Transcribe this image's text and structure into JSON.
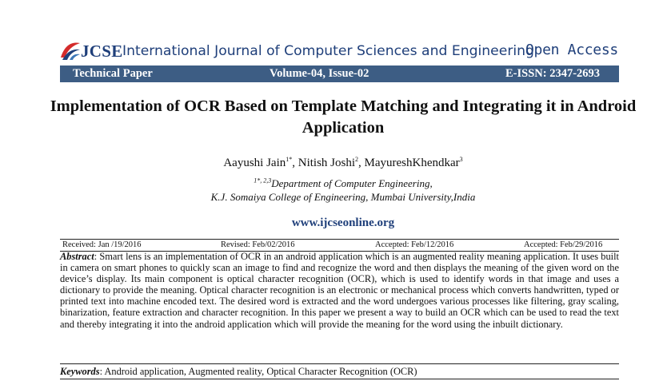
{
  "header": {
    "logo_text": "JCSE",
    "journal_name": "International Journal of Computer Sciences and Engineering",
    "open_access": "Open Access",
    "paper_type": "Technical Paper",
    "volume_issue": "Volume-04, Issue-02",
    "eissn": "E-ISSN: 2347-2693",
    "colors": {
      "brand": "#1f3f7a",
      "bar": "#3d5d84",
      "logo_red": "#d42b2b"
    }
  },
  "paper": {
    "title": "Implementation of OCR Based on Template Matching and Integrating it in Android Application",
    "authors": [
      {
        "name": "Aayushi Jain",
        "sup": "1*"
      },
      {
        "name": "Nitish Joshi",
        "sup": "2"
      },
      {
        "name": "MayureshKhendkar",
        "sup": "3"
      }
    ],
    "author_sep": ", ",
    "affiliation_sup": "1*, 2,3",
    "affiliation_line1": "Department of Computer Engineering,",
    "affiliation_line2": "K.J. Somaiya College of Engineering, Mumbai University,India",
    "website": "www.ijcseonline.org"
  },
  "dates": {
    "received": "Received: Jan /19/2016",
    "revised": "Revised: Feb/02/2016",
    "accepted1": "Accepted: Feb/12/2016",
    "accepted2": "Accepted: Feb/29/2016"
  },
  "abstract": {
    "label": "Abstract",
    "sep": ": ",
    "text": "Smart lens is an implementation of OCR in an android application which is an augmented reality meaning application. It uses built in camera on smart phones to quickly scan an image to find and recognize the word and then displays the meaning of the given word on the device’s display. Its main component is optical character recognition (OCR), which is used to identify words in that image and uses a dictionary to provide the meaning. Optical character recognition is an electronic or mechanical process which converts handwritten, typed or printed text into machine encoded text. The desired word is extracted and the word undergoes various processes like filtering, gray scaling, binarization, feature extraction and character recognition. In this paper we present a way to build an OCR which can be used to read the text and thereby integrating it into the android application which will provide the meaning for the word using the inbuilt dictionary."
  },
  "keywords": {
    "label": "Keywords",
    "sep": ": ",
    "text": "Android application, Augmented reality, Optical Character Recognition (OCR)"
  }
}
